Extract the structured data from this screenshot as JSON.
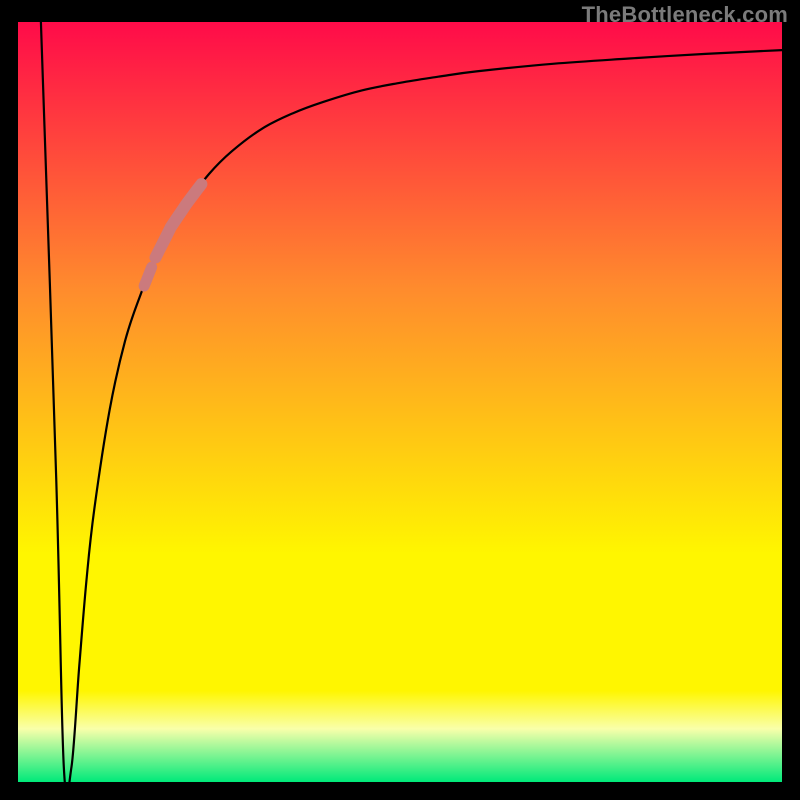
{
  "watermark": "TheBottleneck.com",
  "colors": {
    "frame": "#000000",
    "watermark": "#7b7b7b",
    "gradient_top": "#ff0b49",
    "gradient_mid1": "#ff8b2d",
    "gradient_mid2": "#fff600",
    "gradient_band": "#f9ffaa",
    "gradient_bottom": "#00e97a",
    "curve": "#000000",
    "highlight": "#cb7a7d"
  },
  "chart_data": {
    "type": "line",
    "title": "",
    "xlabel": "",
    "ylabel": "",
    "xlim": [
      0,
      100
    ],
    "ylim": [
      0,
      100
    ],
    "series": [
      {
        "name": "bottleneck-curve",
        "x": [
          3,
          5,
          6,
          7,
          8,
          9,
          10,
          12,
          14,
          16,
          18,
          20,
          22,
          25,
          28,
          32,
          36,
          40,
          45,
          50,
          55,
          60,
          70,
          80,
          90,
          100
        ],
        "y": [
          100,
          40,
          2,
          2,
          15,
          27,
          36,
          49,
          58,
          64,
          69,
          73,
          76,
          80,
          83,
          86,
          88,
          89.5,
          91,
          92,
          92.8,
          93.5,
          94.5,
          95.2,
          95.8,
          96.3
        ]
      }
    ],
    "highlight_segments": [
      {
        "x_start": 18,
        "x_end": 24,
        "thick": true
      },
      {
        "x_start": 16.5,
        "x_end": 17.5,
        "thick": true
      }
    ],
    "gradient_stops_pct": [
      0,
      35,
      70,
      88,
      93,
      100
    ]
  }
}
